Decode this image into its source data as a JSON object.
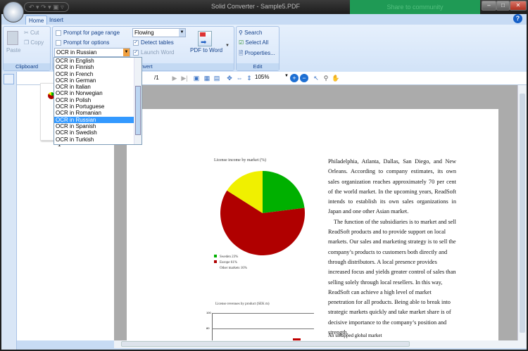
{
  "window": {
    "title": "Solid Converter - Sample5.PDF",
    "share_label": "Share to community",
    "minimize": "–",
    "maximize": "□",
    "close": "✕",
    "qat": "↶ ▾ ↷ ▾ ▣ ▿"
  },
  "tabs": [
    "Home",
    "Insert"
  ],
  "help": "?",
  "clipboard": {
    "paste": "Paste",
    "cut": "Cut",
    "copy": "Copy",
    "label": "Clipboard"
  },
  "convert": {
    "prompt_page_range": "Prompt for page range",
    "prompt_options": "Prompt for options",
    "ocr_value": "OCR in Russian",
    "layout_value": "Flowing",
    "detect_tables": "Detect tables",
    "launch_word": "Launch Word",
    "pdf_to_word": "PDF to Word",
    "label": "Convert",
    "label_visible": "ert"
  },
  "edit": {
    "search": "Search",
    "select_all": "Select All",
    "properties": "Properties...",
    "label": "Edit"
  },
  "ocr_options": [
    "OCR in English",
    "OCR in Finnish",
    "OCR in French",
    "OCR in German",
    "OCR in Italian",
    "OCR in Norwegian",
    "OCR in Polish",
    "OCR in Portuguese",
    "OCR in Romanian",
    "OCR in Russian",
    "OCR in Spanish",
    "OCR in Swedish",
    "OCR in Turkish"
  ],
  "ocr_selected_index": 9,
  "toolbar": {
    "page_total": "/1",
    "zoom": "105%"
  },
  "thumbnail": {
    "page_label": "1"
  },
  "document": {
    "paragraphs": [
      "Philadelphia, Atlanta, Dallas, San Diego, and New Orleans. According to company estimates, its own sales organization reaches approximately 70 per cent of the world market. In the upcoming years, ReadSoft intends to establish its own sales organizations in Japan and one other Asian market.",
      "The function of the subsidiaries is to market and sell ReadSoft products and to provide support on local markets. Our sales and marketing strategy is to sell the company’s products to customers both directly and through distributors. A local presence provides increased focus and yields greater control of sales than selling solely through local resellers. In this way, ReadSoft can achieve a high level of market penetration for all products. Being able to break into strategic markets quickly and take market share is of decisive importance to the company’s position and strength."
    ],
    "heading": "An untapped global market"
  },
  "chart_data": [
    {
      "type": "pie",
      "title": "License income by market (%)",
      "categories": [
        "Sweden",
        "Europe",
        "Other markets"
      ],
      "values": [
        23,
        61,
        16
      ],
      "legend": [
        "Sweden 23%",
        "Europe 61%",
        "Other markets 16%"
      ],
      "colors": [
        "#00b000",
        "#b00000",
        "#f0f000"
      ],
      "legend_position": "bottom-left"
    },
    {
      "type": "bar",
      "title": "License revenues by product (SEK m)",
      "y_ticks": [
        "100",
        "80"
      ],
      "ylim": [
        0,
        100
      ],
      "partial": true
    }
  ]
}
